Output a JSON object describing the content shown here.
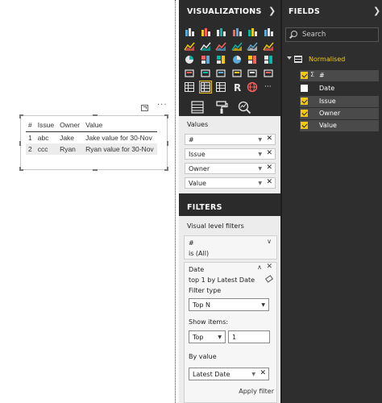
{
  "table_visual": {
    "columns": [
      "#",
      "Issue",
      "Owner",
      "Value"
    ],
    "rows": [
      [
        "1",
        "abc",
        "Jake",
        "Jake value for 30-Nov"
      ],
      [
        "2",
        "ccc",
        "Ryan",
        "Ryan value for 30-Nov"
      ]
    ],
    "header_icons": [
      "focus-mode-icon",
      "more-options-icon"
    ],
    "more_label": "···"
  },
  "visualizations": {
    "title": "VISUALIZATIONS",
    "collapse_icon": "chevron-right-icon",
    "icons": [
      "stacked-bar-chart",
      "stacked-column-chart",
      "clustered-bar-chart",
      "clustered-column-chart",
      "100-stacked-bar-chart",
      "100-stacked-column-chart",
      "line-chart",
      "area-chart",
      "stacked-area-chart",
      "line-and-stacked-column-chart",
      "line-and-clustered-column-chart",
      "ribbon-chart",
      "waterfall-chart",
      "scatter-chart",
      "pie-chart",
      "donut-chart",
      "treemap",
      "map",
      "filled-map",
      "funnel",
      "gauge",
      "multi-row-card",
      "card",
      "kpi",
      "slicer",
      "table",
      "matrix",
      "r-script-visual",
      "globe-map",
      "more-visuals"
    ],
    "selected_icon": "table",
    "tabs": [
      "fields-tab",
      "format-tab",
      "analytics-tab"
    ],
    "values_label": "Values",
    "wells": [
      "#",
      "Issue",
      "Owner",
      "Value"
    ]
  },
  "filters": {
    "title": "FILTERS",
    "section_label": "Visual level filters",
    "cards": [
      {
        "name": "#",
        "summary": "is (All)"
      },
      {
        "name": "Date",
        "summary": "top 1 by Latest Date"
      }
    ],
    "filter_type_label": "Filter type",
    "filter_type_value": "Top N",
    "show_items_label": "Show items:",
    "show_items_direction": "Top",
    "show_items_count": "1",
    "by_value_label": "By value",
    "by_value_field": "Latest Date",
    "apply_label": "Apply filter"
  },
  "fields": {
    "title": "FIELDS",
    "expand_icon": "chevron-right-icon",
    "search_placeholder": "Search",
    "table_name": "Normalised",
    "items": [
      {
        "label": "#",
        "checked": true,
        "sigma": "Σ"
      },
      {
        "label": "Date",
        "checked": false
      },
      {
        "label": "Issue",
        "checked": true
      },
      {
        "label": "Owner",
        "checked": true
      },
      {
        "label": "Value",
        "checked": true
      }
    ]
  },
  "colors": {
    "accent": "#f2c80f",
    "pane_dark": "#2b2b2b",
    "pane_light": "#ececec"
  }
}
